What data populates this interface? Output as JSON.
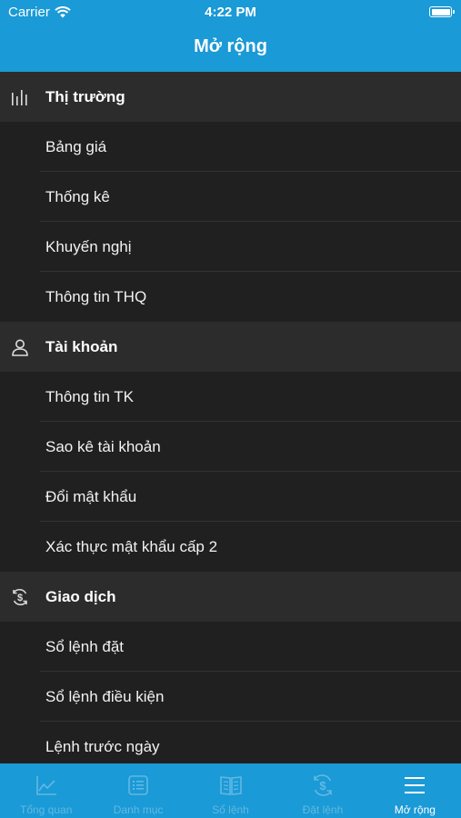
{
  "status_bar": {
    "carrier": "Carrier",
    "time": "4:22 PM"
  },
  "header": {
    "title": "Mở rộng"
  },
  "sections": [
    {
      "title": "Thị trường",
      "icon": "chart-bars-icon",
      "items": [
        "Bảng giá",
        "Thống kê",
        "Khuyến nghị",
        "Thông tin THQ"
      ]
    },
    {
      "title": "Tài khoản",
      "icon": "user-icon",
      "items": [
        "Thông tin TK",
        "Sao kê tài khoản",
        "Đổi mật khẩu",
        "Xác thực mật khẩu cấp 2"
      ]
    },
    {
      "title": "Giao dịch",
      "icon": "dollar-cycle-icon",
      "items": [
        "Sổ lệnh đặt",
        "Sổ lệnh điều kiện",
        "Lệnh trước ngày"
      ]
    }
  ],
  "tabbar": {
    "tabs": [
      {
        "label": "Tổng quan",
        "icon": "line-chart-icon"
      },
      {
        "label": "Danh mục",
        "icon": "list-icon"
      },
      {
        "label": "Sổ lệnh",
        "icon": "book-icon"
      },
      {
        "label": "Đặt lệnh",
        "icon": "dollar-cycle-icon"
      },
      {
        "label": "Mở rộng",
        "icon": "menu-icon"
      }
    ],
    "active_index": 4
  },
  "colors": {
    "accent": "#1a9ad6",
    "background": "#202020",
    "section_bg": "#2c2c2c",
    "inactive_tab": "#62b8e2"
  }
}
